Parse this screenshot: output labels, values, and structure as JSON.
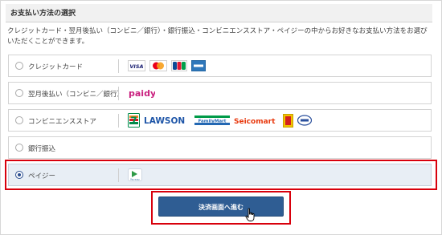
{
  "section": {
    "title": "お支払い方法の選択"
  },
  "description": "クレジットカード・翌月後払い（コンビニ／銀行）・銀行振込・コンビニエンスストア・ペイジーの中からお好きなお支払い方法をお選びいただくことができます。",
  "options": [
    {
      "label": "クレジットカード",
      "selected": false,
      "logos": [
        {
          "name": "visa-logo",
          "text": "VISA"
        },
        {
          "name": "mastercard-logo",
          "text": ""
        },
        {
          "name": "jcb-logo",
          "text": "JCB"
        },
        {
          "name": "amex-logo",
          "text": ""
        }
      ]
    },
    {
      "label": "翌月後払い（コンビニ／銀行）",
      "selected": false,
      "logos": [
        {
          "name": "paidy-logo",
          "text": "paidy"
        }
      ]
    },
    {
      "label": "コンビニエンスストア",
      "selected": false,
      "logos": [
        {
          "name": "seven-eleven-logo",
          "text": "7"
        },
        {
          "name": "lawson-logo",
          "text": "LAWSON"
        },
        {
          "name": "familymart-logo",
          "text": "FamilyMart"
        },
        {
          "name": "seicomart-logo",
          "text": "Seicomart"
        },
        {
          "name": "ministop-logo",
          "text": ""
        },
        {
          "name": "daily-yamazaki-logo",
          "text": ""
        }
      ]
    },
    {
      "label": "銀行振込",
      "selected": false,
      "logos": []
    },
    {
      "label": "ペイジー",
      "selected": true,
      "logos": [
        {
          "name": "payeasy-logo",
          "text": "Pay-easy"
        }
      ]
    }
  ],
  "submit": {
    "label": "決済画面へ進む"
  },
  "colors": {
    "accent": "#2f5d93",
    "highlight": "#d8000c",
    "selected_bg": "#e8eef5"
  }
}
